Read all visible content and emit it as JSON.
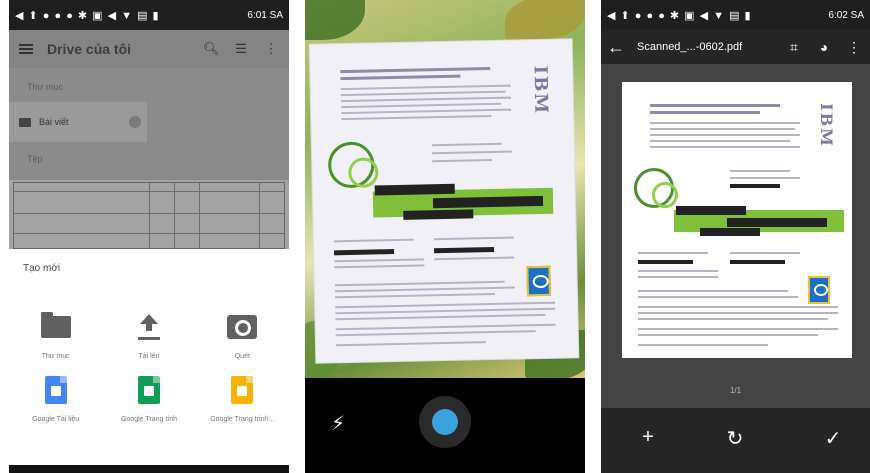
{
  "panel_drive": {
    "status_time": "6:01 SA",
    "title": "Drive của tôi",
    "section_folders": "Thư mục",
    "folder_name": "Bài viết",
    "section_files": "Tệp",
    "sheet_title": "Tạo mới",
    "items": [
      {
        "label": "Thư mục",
        "icon": "folder-icon"
      },
      {
        "label": "Tải lên",
        "icon": "upload-icon"
      },
      {
        "label": "Quét",
        "icon": "camera-icon"
      },
      {
        "label": "Google Tài liệu",
        "icon": "google-docs-icon",
        "color": "#4285f4"
      },
      {
        "label": "Google Trang tính",
        "icon": "google-sheets-icon",
        "color": "#0f9d58"
      },
      {
        "label": "Google Trang trình...",
        "icon": "google-slides-icon",
        "color": "#f4b400"
      }
    ]
  },
  "panel_camera": {
    "doc_brand": "IBM",
    "shutter_color": "#3aa3dc"
  },
  "panel_preview": {
    "status_time": "6:02 SA",
    "file_title": "Scanned_...-0602.pdf",
    "doc_brand": "IBM",
    "page_counter": "1/1"
  }
}
